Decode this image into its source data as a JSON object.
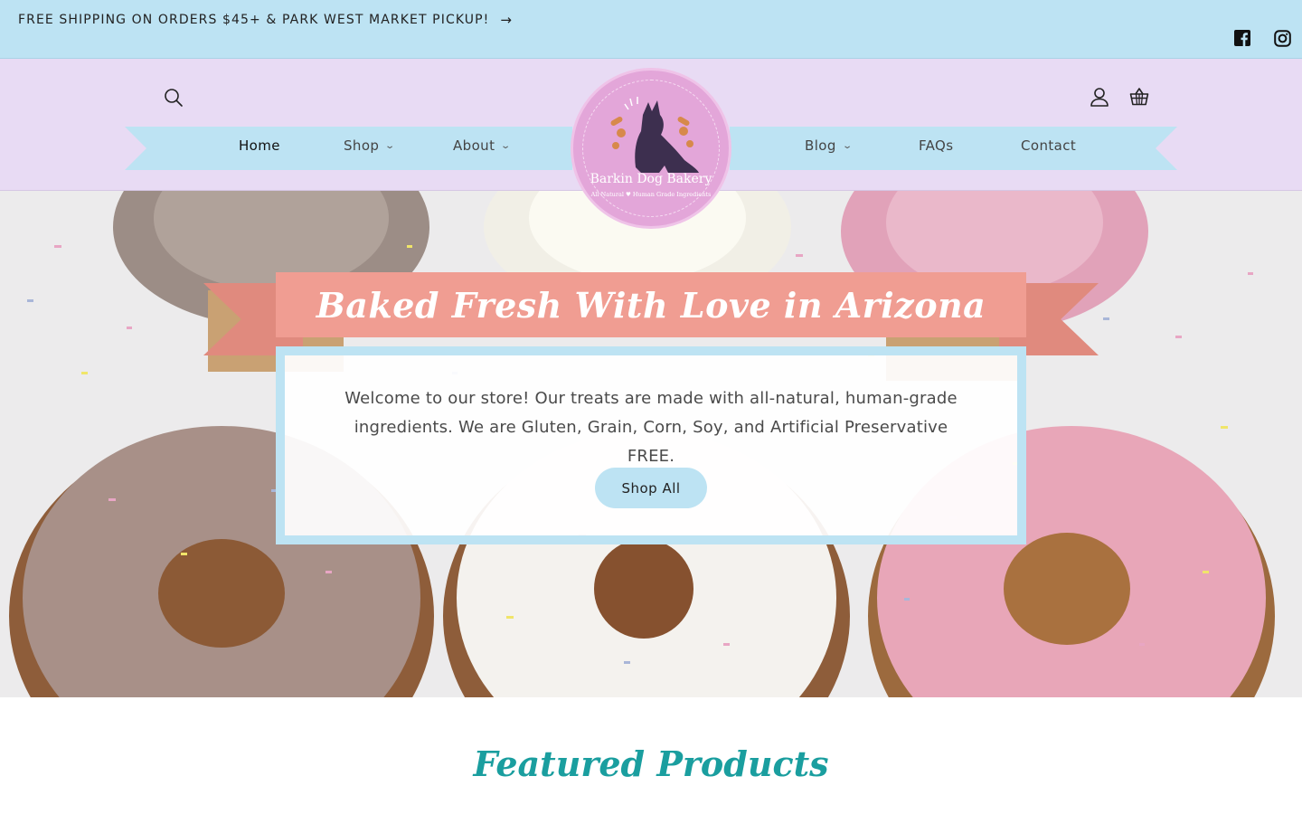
{
  "announcement": {
    "text": "FREE SHIPPING ON ORDERS $45+ & PARK WEST MARKET PICKUP!",
    "arrow_icon": "arrow-right-icon"
  },
  "social": [
    "facebook-icon",
    "instagram-icon"
  ],
  "header": {
    "icons": [
      "search-icon",
      "account-icon",
      "cart-icon"
    ],
    "nav_left": [
      {
        "label": "Home",
        "active": true,
        "dropdown": false
      },
      {
        "label": "Shop",
        "dropdown": true
      },
      {
        "label": "About",
        "dropdown": true
      }
    ],
    "nav_right": [
      {
        "label": "Blog",
        "dropdown": true
      },
      {
        "label": "FAQs",
        "dropdown": false
      },
      {
        "label": "Contact",
        "dropdown": false
      }
    ],
    "logo": {
      "name": "Barkin Dog Bakery",
      "tagline": "All Natural ♥ Human Grade Ingredients"
    }
  },
  "hero": {
    "title": "Baked Fresh With Love in Arizona",
    "body": "Welcome to our store! Our treats are made with all-natural, human-grade ingredients. We are Gluten, Grain, Corn, Soy, and Artificial Preservative FREE.",
    "button": "Shop All"
  },
  "featured": {
    "heading": "Featured Products"
  },
  "colors": {
    "announcement_bg": "#bde3f3",
    "header_bg": "#e8dbf4",
    "ribbon": "#bde3f3",
    "banner": "#f09d92",
    "banner_tail": "#e08a7e",
    "logo": "#e3a6d9",
    "featured_heading": "#1a9e9f"
  }
}
